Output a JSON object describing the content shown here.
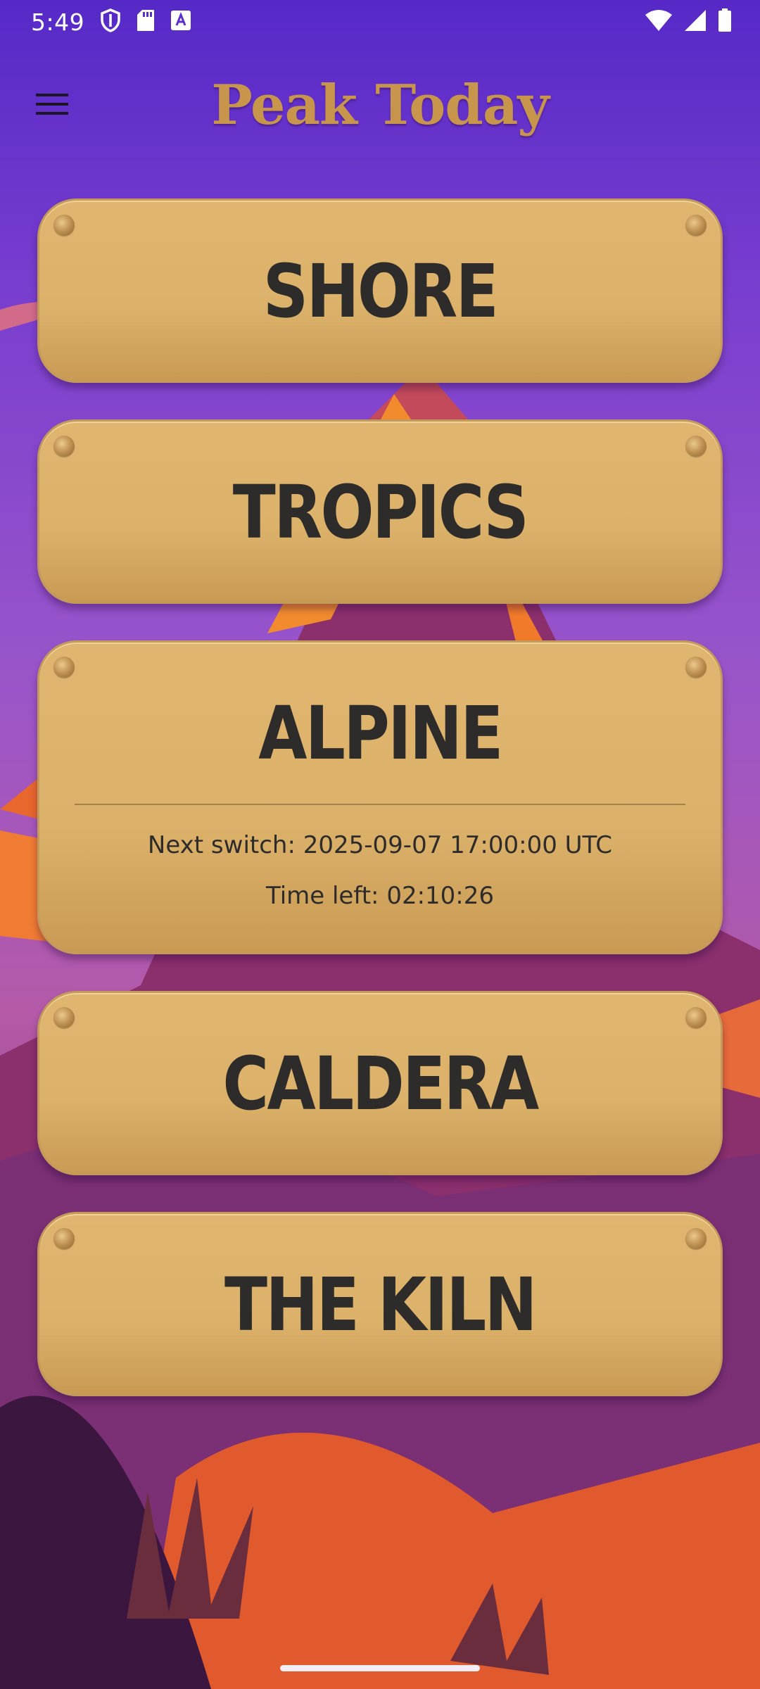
{
  "status_bar": {
    "time": "5:49",
    "left_icons": [
      "shield-icon",
      "sd-card-icon",
      "keyboard-a-icon"
    ],
    "right_icons": [
      "wifi-icon",
      "cell-signal-icon",
      "battery-icon"
    ]
  },
  "app_bar": {
    "menu_icon": "hamburger-menu-icon",
    "title": "Peak Today"
  },
  "plates": [
    {
      "label": "SHORE",
      "expanded": false
    },
    {
      "label": "TROPICS",
      "expanded": false
    },
    {
      "label": "ALPINE",
      "expanded": true,
      "next_switch": "Next switch: 2025-09-07 17:00:00 UTC",
      "time_left": "Time left: 02:10:26"
    },
    {
      "label": "CALDERA",
      "expanded": false
    },
    {
      "label": "THE KILN",
      "expanded": false
    }
  ],
  "colors": {
    "title": "#c8954d",
    "plate": "#dcb26b",
    "plate_text": "#2e2c2b",
    "sky_top": "#5a2ec8"
  }
}
